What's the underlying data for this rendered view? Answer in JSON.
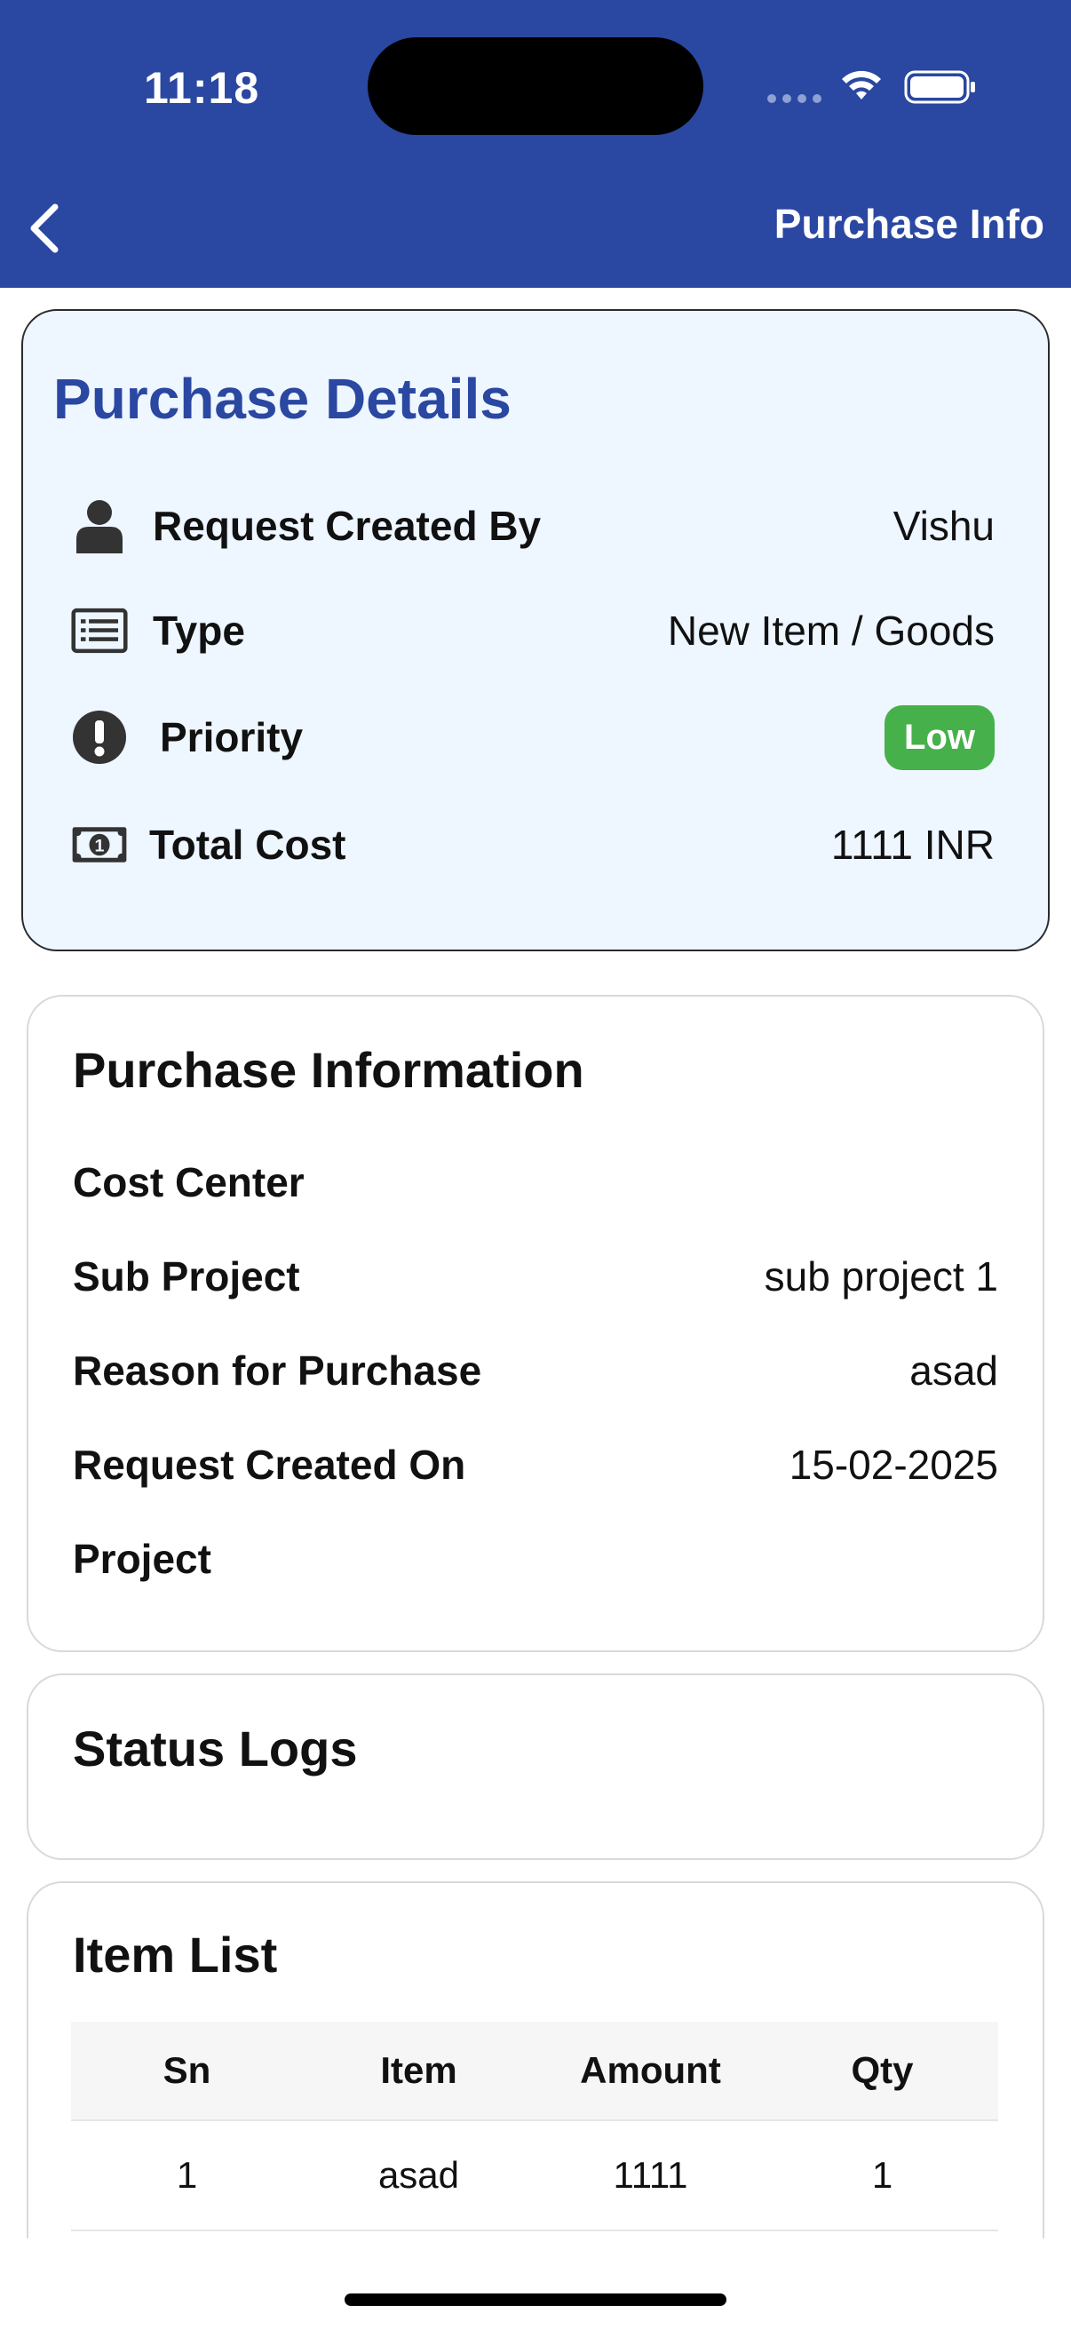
{
  "status_bar": {
    "time": "11:18"
  },
  "header": {
    "title": "Purchase Info"
  },
  "purchase_details": {
    "title": "Purchase Details",
    "rows": [
      {
        "label": "Request Created By",
        "value": "Vishu",
        "icon": "person-icon"
      },
      {
        "label": "Type",
        "value": "New Item / Goods",
        "icon": "list-icon"
      },
      {
        "label": "Priority",
        "value": "Low",
        "icon": "exclamation-icon",
        "badge_color": "#46b14b"
      },
      {
        "label": "Total Cost",
        "value": "1111 INR",
        "icon": "money-icon"
      }
    ]
  },
  "purchase_information": {
    "title": "Purchase Information",
    "rows": [
      {
        "label": "Cost Center",
        "value": ""
      },
      {
        "label": "Sub Project",
        "value": "sub project 1"
      },
      {
        "label": "Reason for Purchase",
        "value": "asad"
      },
      {
        "label": "Request Created On",
        "value": "15-02-2025"
      },
      {
        "label": "Project",
        "value": ""
      }
    ]
  },
  "status_logs": {
    "title": "Status Logs"
  },
  "item_list": {
    "title": "Item List",
    "columns": [
      "Sn",
      "Item",
      "Amount",
      "Qty"
    ],
    "rows": [
      [
        "1",
        "asad",
        "1111",
        "1"
      ]
    ]
  },
  "colors": {
    "header": "#2a47a1",
    "details_bg": "#eef6ff",
    "accent": "#2a47a1",
    "priority_low": "#46b14b"
  }
}
